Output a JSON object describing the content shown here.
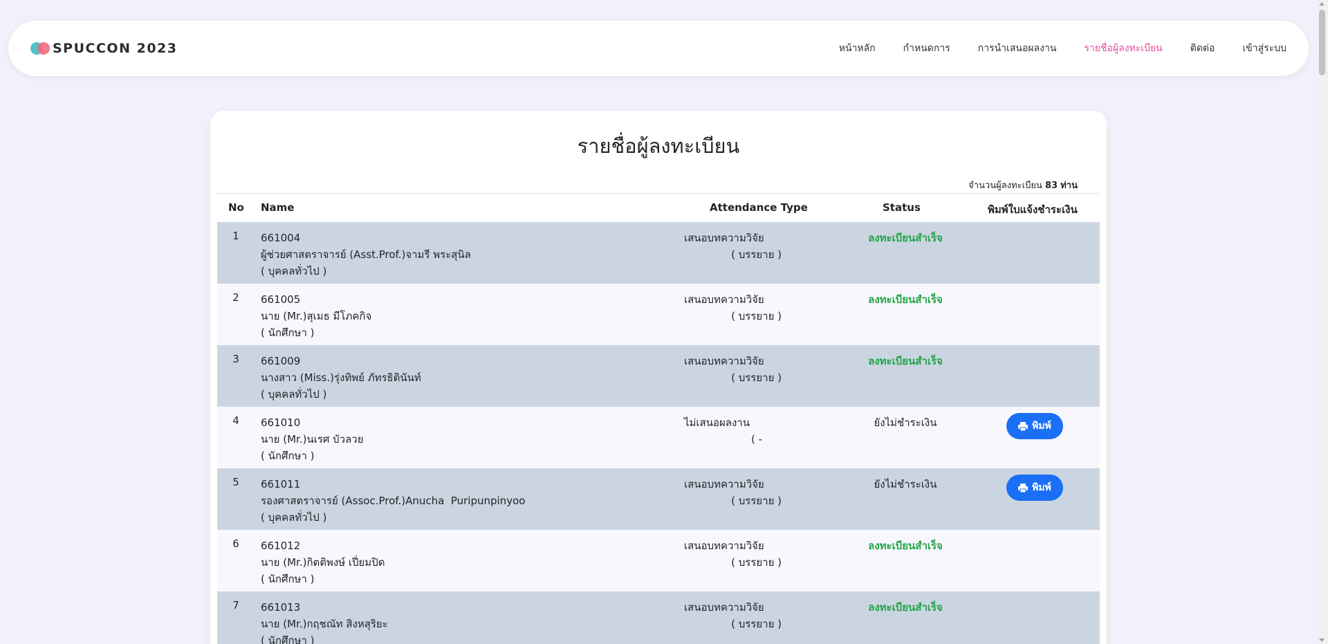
{
  "brand": {
    "name": "SPUCCON 2023"
  },
  "nav": {
    "items": [
      {
        "label": "หน้าหลัก"
      },
      {
        "label": "กำหนดการ"
      },
      {
        "label": "การนำเสนอผลงาน"
      },
      {
        "label": "รายชื่อผู้ลงทะเบียน"
      },
      {
        "label": "ติดต่อ"
      },
      {
        "label": "เข้าสู่ระบบ"
      }
    ],
    "active_color": "#e84e9b"
  },
  "page": {
    "title": "รายชื่อผู้ลงทะเบียน",
    "count_prefix": "จำนวนผู้ลงทะเบียน",
    "count_value": "83",
    "count_suffix": "ท่าน"
  },
  "table": {
    "headers": {
      "no": "No",
      "name": "Name",
      "attendance": "Attendance Type",
      "status": "Status",
      "print": "พิมพ์ใบแจ้งชำระเงิน"
    },
    "rows": [
      {
        "no": "1",
        "code": "661004",
        "fullname": "ผู้ช่วยศาสตราจารย์ (Asst.Prof.)จามรี พระสุนิล",
        "group": "( บุคคลทั่วไป )",
        "attendance": "เสนอบทความวิจัย",
        "attendance_sub": "( บรรยาย )",
        "status": "ลงทะเบียนสำเร็จ"
      },
      {
        "no": "2",
        "code": "661005",
        "fullname": "นาย (Mr.)สุเมธ มีโภคกิจ",
        "group": "( นักศึกษา )",
        "attendance": "เสนอบทความวิจัย",
        "attendance_sub": "( บรรยาย )",
        "status": "ลงทะเบียนสำเร็จ"
      },
      {
        "no": "3",
        "code": "661009",
        "fullname": "นางสาว (Miss.)รุ่งทิพย์ ภัทรธิตินันท์",
        "group": "( บุคคลทั่วไป )",
        "attendance": "เสนอบทความวิจัย",
        "attendance_sub": "( บรรยาย )",
        "status": "ลงทะเบียนสำเร็จ"
      },
      {
        "no": "4",
        "code": "661010",
        "fullname": "นาย (Mr.)นเรศ บัวลวย",
        "group": "( นักศึกษา )",
        "attendance": "ไม่เสนอผลงาน",
        "attendance_sub": "( -",
        "status": "ยังไม่ชำระเงิน",
        "print_label": "พิมพ์"
      },
      {
        "no": "5",
        "code": "661011",
        "fullname": "รองศาสตราจารย์ (Assoc.Prof.)Anucha  Puripunpinyoo",
        "group": "( บุคคลทั่วไป )",
        "attendance": "เสนอบทความวิจัย",
        "attendance_sub": "( บรรยาย )",
        "status": "ยังไม่ชำระเงิน",
        "print_label": "พิมพ์"
      },
      {
        "no": "6",
        "code": "661012",
        "fullname": "นาย (Mr.)กิตติพงษ์ เปี่ยมปิด",
        "group": "( นักศึกษา )",
        "attendance": "เสนอบทความวิจัย",
        "attendance_sub": "( บรรยาย )",
        "status": "ลงทะเบียนสำเร็จ"
      },
      {
        "no": "7",
        "code": "661013",
        "fullname": "นาย (Mr.)กฤชณัท สิงหสุริยะ",
        "group": "( นักศึกษา )",
        "attendance": "เสนอบทความวิจัย",
        "attendance_sub": "( บรรยาย )",
        "status": "ลงทะเบียนสำเร็จ"
      }
    ]
  },
  "colors": {
    "status_ok": "#22a447",
    "print_button": "#1a6ff5",
    "row_alt": "#cbd5e1"
  },
  "icons": {
    "print": "printer-icon"
  }
}
